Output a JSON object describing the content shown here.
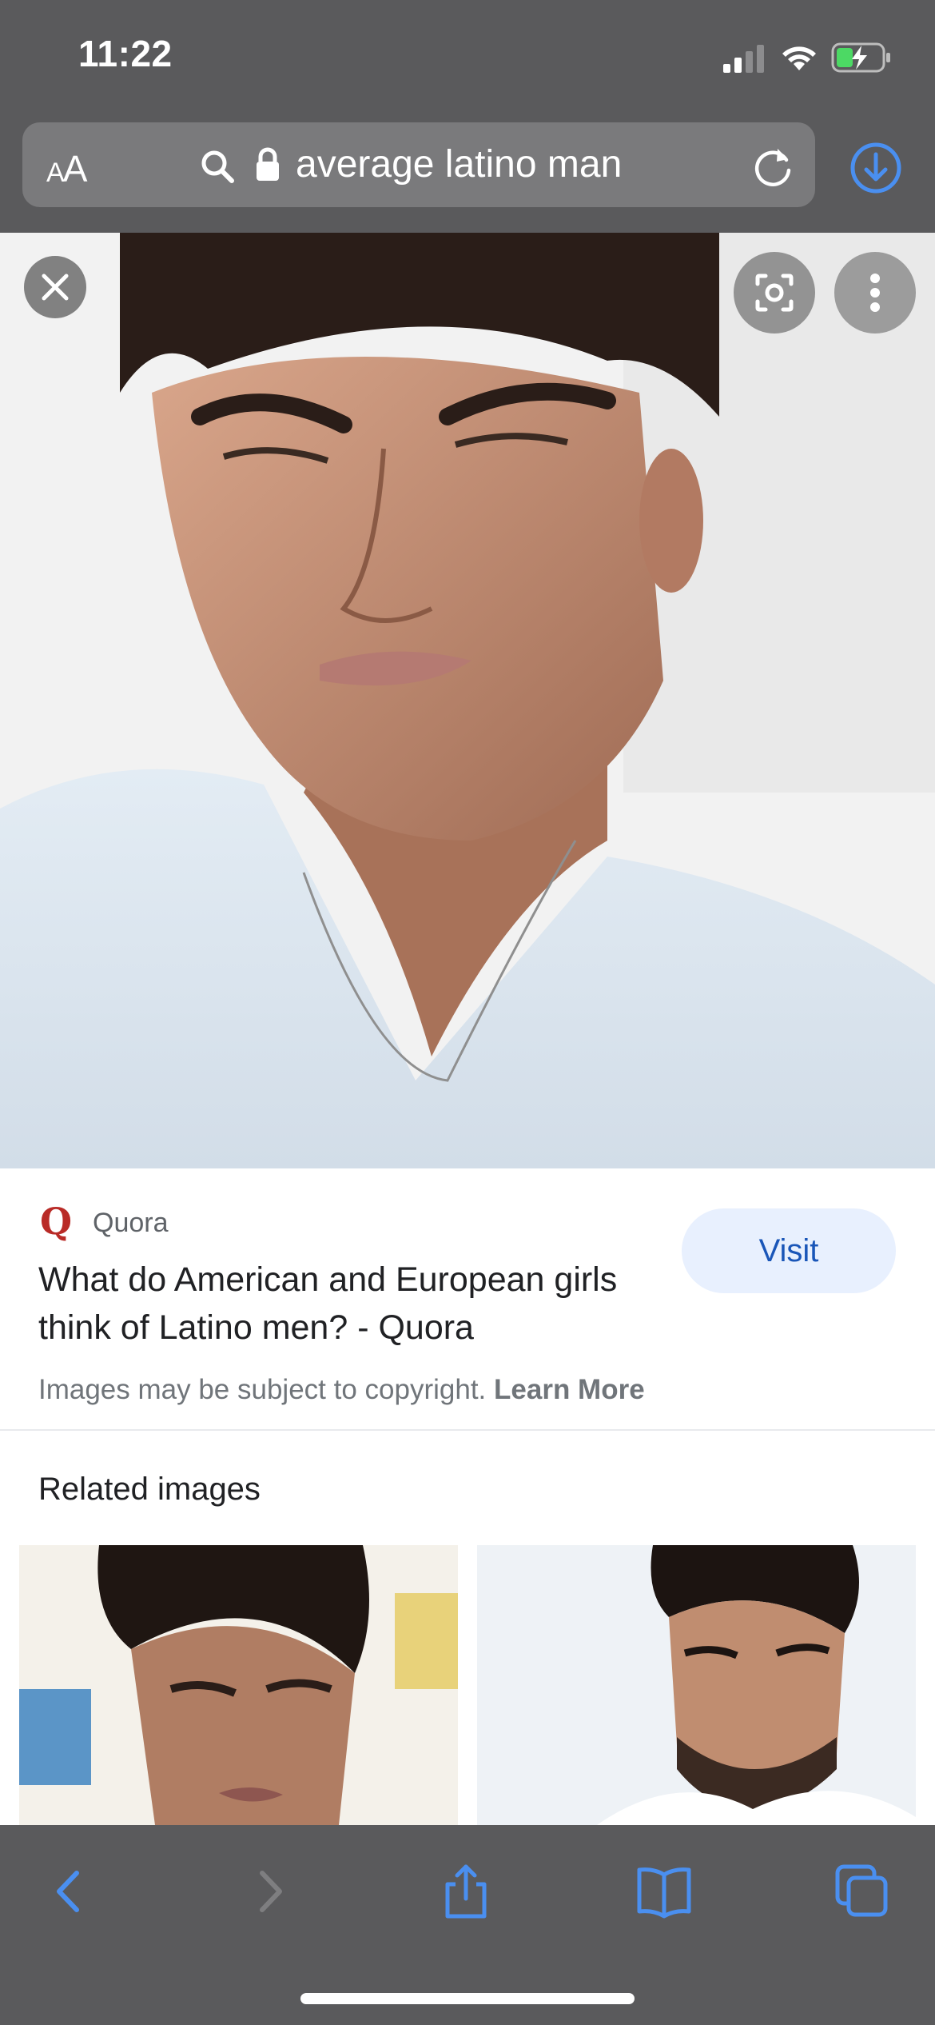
{
  "status_bar": {
    "time": "11:22"
  },
  "address_bar": {
    "text_size_label_small": "A",
    "text_size_label_large": "A",
    "url": "average latino man"
  },
  "main_image": {
    "alt": "",
    "icons": [
      "close-icon",
      "lens-icon",
      "more-vert-icon"
    ]
  },
  "result": {
    "source": "Quora",
    "source_logo": "Q",
    "title": "What do American and European girls think of Latino men? - Quora",
    "visit_label": "Visit",
    "copyright_text": "Images may be subject to copyright.",
    "learn_more": "Learn More"
  },
  "related": {
    "heading": "Related images"
  },
  "toolbar": {
    "icons": [
      "back-icon",
      "forward-icon",
      "share-icon",
      "bookmarks-icon",
      "tabs-icon"
    ]
  },
  "colors": {
    "chrome": "#5a5a5c",
    "accent_blue": "#4a8ff0",
    "quora_red": "#b92b27",
    "visit_bg": "#e8f0fe"
  }
}
